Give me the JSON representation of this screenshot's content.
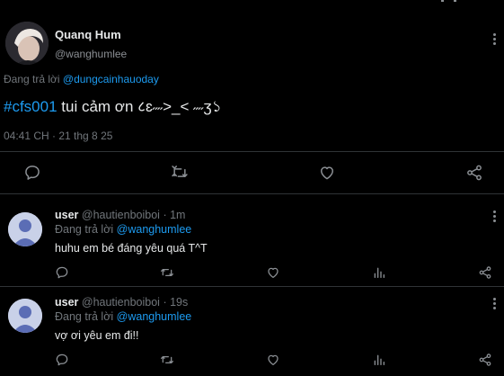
{
  "main_post": {
    "display_name": "Quanq Hum",
    "handle": "@wanghumlee",
    "reply_prefix": "Đang trả lời",
    "reply_to": "@dungcainhauoday",
    "hashtag": "#cfs001",
    "body": "tui cảm ơn ८ɛ˶˶>_< ˶˶ʒ১",
    "timestamp": "04:41 CH · 21 thg 8 25"
  },
  "replies": [
    {
      "display_name": "user",
      "handle": "@hautienboiboi",
      "time": "· 1m",
      "reply_prefix": "Đang trả lời",
      "reply_to": "@wanghumlee",
      "body": "huhu em bé đáng yêu quá T^T"
    },
    {
      "display_name": "user",
      "handle": "@hautienboiboi",
      "time": "· 19s",
      "reply_prefix": "Đang trả lời",
      "reply_to": "@wanghumlee",
      "body": "vợ ơi yêu em đi!!"
    }
  ],
  "icons": {
    "reply": "reply-icon",
    "retweet": "retweet-icon",
    "like": "heart-icon",
    "views": "views-icon",
    "share": "share-icon",
    "more": "more-options-icon"
  },
  "colors": {
    "background": "#000000",
    "link": "#1d9bf0",
    "muted": "#71767b",
    "divider": "#2f3336"
  }
}
